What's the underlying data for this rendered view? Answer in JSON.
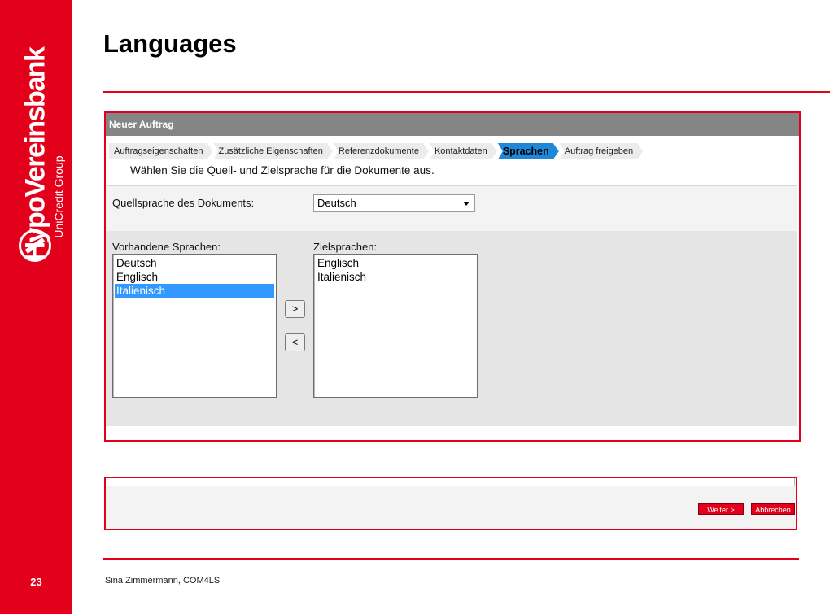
{
  "brand": {
    "name": "HypoVereinsbank",
    "group": "UniCredit Group",
    "color": "#e2001a"
  },
  "slide": {
    "title": "Languages",
    "page_number": "23",
    "footer": "Sina Zimmermann, COM4LS"
  },
  "window": {
    "title": "Neuer Auftrag"
  },
  "steps": [
    {
      "label": "Auftragseigenschaften",
      "active": false
    },
    {
      "label": "Zusätzliche Eigenschaften",
      "active": false
    },
    {
      "label": "Referenzdokumente",
      "active": false
    },
    {
      "label": "Kontaktdaten",
      "active": false
    },
    {
      "label": "Sprachen",
      "active": true
    },
    {
      "label": "Auftrag freigeben",
      "active": false
    }
  ],
  "instruction": "Wählen Sie die Quell- und Zielsprache für die Dokumente aus.",
  "source_language": {
    "label": "Quellsprache des Dokuments:",
    "value": "Deutsch"
  },
  "available": {
    "label": "Vorhandene Sprachen:",
    "items": [
      "Deutsch",
      "Englisch",
      "Italienisch"
    ],
    "selected": "Italienisch"
  },
  "target": {
    "label": "Zielsprachen:",
    "items": [
      "Englisch",
      "Italienisch"
    ]
  },
  "move_buttons": {
    "add": ">",
    "remove": "<"
  },
  "footer_buttons": {
    "next": "Weiter >",
    "cancel": "Abbrechen"
  }
}
